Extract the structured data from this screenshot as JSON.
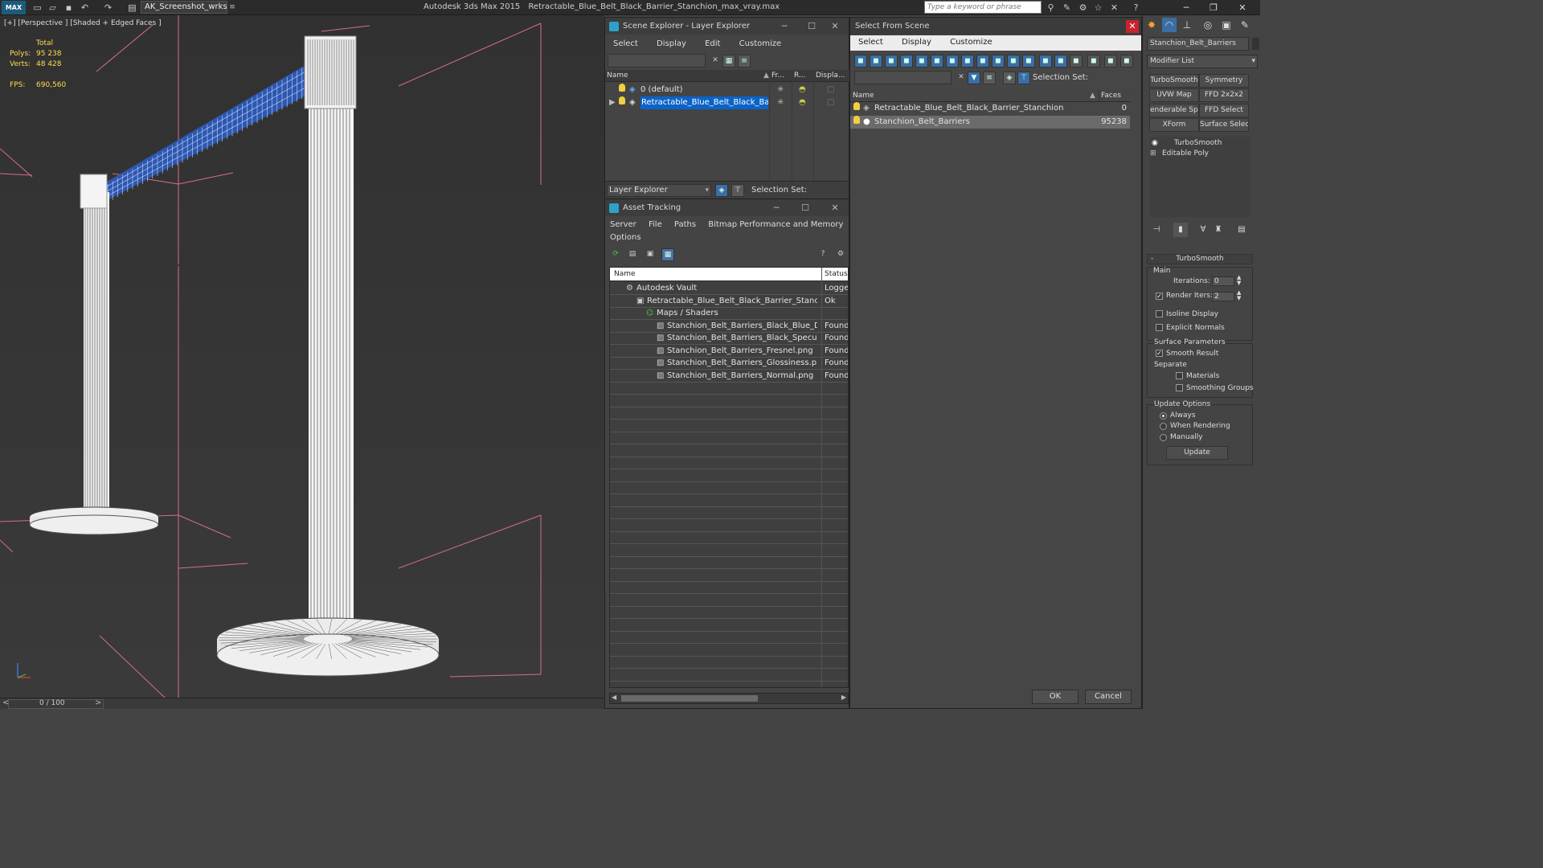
{
  "titlebar": {
    "logo": "MAX",
    "workspace": "AK_Screenshot_wrksp",
    "app_name": "Autodesk 3ds Max  2015",
    "file_name": "Retractable_Blue_Belt_Black_Barrier_Stanchion_max_vray.max",
    "search_placeholder": "Type a keyword or phrase"
  },
  "viewport": {
    "label": "[+] [Perspective ] [Shaded + Edged Faces ]",
    "stats": {
      "total_label": "Total",
      "polys_label": "Polys:",
      "polys_value": "95 238",
      "verts_label": "Verts:",
      "verts_value": "48 428",
      "fps_label": "FPS:",
      "fps_value": "690,560"
    }
  },
  "timeslider": {
    "text": "0 / 100",
    "left": "<",
    "right": ">"
  },
  "scene_explorer": {
    "title": "Scene Explorer - Layer Explorer",
    "menu": [
      "Select",
      "Display",
      "Edit",
      "Customize"
    ],
    "columns": {
      "name": "Name",
      "frozen": "Fr...",
      "render": "R...",
      "display": "Displa..."
    },
    "rows": [
      "0 (default)",
      "Retractable_Blue_Belt_Black_Barrier_..."
    ],
    "footer_dropdown": "Layer Explorer",
    "selection_set": "Selection Set:"
  },
  "asset_tracking": {
    "title": "Asset Tracking",
    "menu": [
      "Server",
      "File",
      "Paths",
      "Bitmap Performance and Memory"
    ],
    "menu2": "Options",
    "columns": {
      "name": "Name",
      "status": "Status"
    },
    "rows": [
      {
        "name": "Autodesk Vault",
        "status": "Logged"
      },
      {
        "name": "Retractable_Blue_Belt_Black_Barrier_Stanchion_...",
        "status": "Ok"
      },
      {
        "name": "Maps / Shaders",
        "status": ""
      },
      {
        "name": "Stanchion_Belt_Barriers_Black_Blue_Diffus...",
        "status": "Found"
      },
      {
        "name": "Stanchion_Belt_Barriers_Black_Specular.png",
        "status": "Found"
      },
      {
        "name": "Stanchion_Belt_Barriers_Fresnel.png",
        "status": "Found"
      },
      {
        "name": "Stanchion_Belt_Barriers_Glossiness.png",
        "status": "Found"
      },
      {
        "name": "Stanchion_Belt_Barriers_Normal.png",
        "status": "Found"
      }
    ]
  },
  "select_from_scene": {
    "title": "Select From Scene",
    "menu": [
      "Select",
      "Display",
      "Customize"
    ],
    "selection_set": "Selection Set:",
    "columns": {
      "name": "Name",
      "faces": "Faces"
    },
    "rows": [
      {
        "name": "Retractable_Blue_Belt_Black_Barrier_Stanchion",
        "faces": "0"
      },
      {
        "name": "Stanchion_Belt_Barriers",
        "faces": "95238"
      }
    ],
    "ok": "OK",
    "cancel": "Cancel"
  },
  "command_panel": {
    "object_name": "Stanchion_Belt_Barriers",
    "modifier_list": "Modifier List",
    "buttons": [
      "TurboSmooth",
      "Symmetry",
      "UVW Map",
      "FFD 2x2x2",
      "enderable Spli",
      "FFD Select",
      "XForm",
      "Surface Select"
    ],
    "stack": [
      "TurboSmooth",
      "Editable Poly"
    ],
    "rollout_title": "TurboSmooth",
    "main_label": "Main",
    "iterations_label": "Iterations:",
    "iterations_value": "0",
    "render_iters_label": "Render Iters:",
    "render_iters_value": "2",
    "isoline": "Isoline Display",
    "explicit_normals": "Explicit Normals",
    "surface_params": "Surface Parameters",
    "smooth_result": "Smooth Result",
    "separate": "Separate",
    "materials": "Materials",
    "smoothing_groups": "Smoothing Groups",
    "update_options": "Update Options",
    "always": "Always",
    "when_rendering": "When Rendering",
    "manually": "Manually",
    "update_button": "Update"
  }
}
